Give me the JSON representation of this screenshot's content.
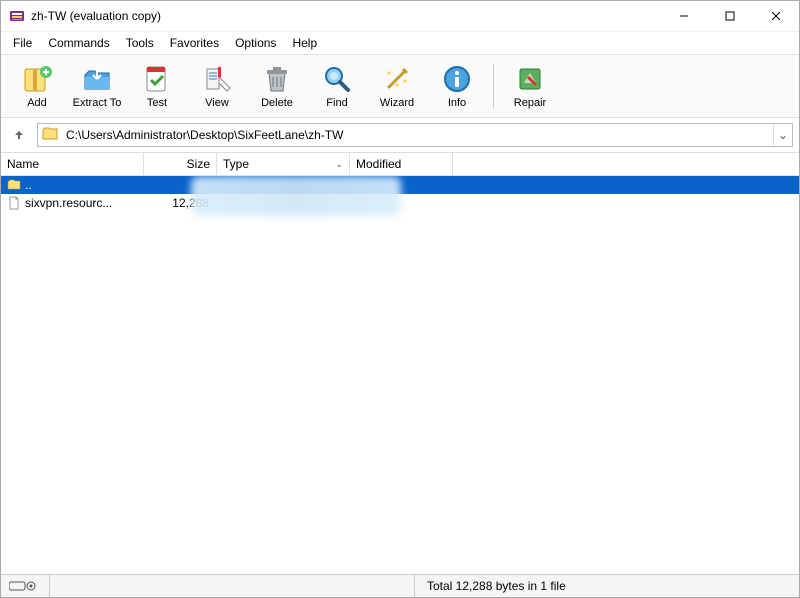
{
  "window": {
    "title": "zh-TW (evaluation copy)"
  },
  "menu": {
    "file": "File",
    "commands": "Commands",
    "tools": "Tools",
    "favorites": "Favorites",
    "options": "Options",
    "help": "Help"
  },
  "toolbar": {
    "add": "Add",
    "extract": "Extract To",
    "test": "Test",
    "view": "View",
    "delete": "Delete",
    "find": "Find",
    "wizard": "Wizard",
    "info": "Info",
    "repair": "Repair"
  },
  "nav": {
    "path": "C:\\Users\\Administrator\\Desktop\\SixFeetLane\\zh-TW"
  },
  "columns": {
    "name": "Name",
    "size": "Size",
    "type": "Type",
    "modified": "Modified"
  },
  "rows": {
    "parent": {
      "name": ".."
    },
    "file1": {
      "name": "sixvpn.resourc...",
      "size": "12,288"
    }
  },
  "status": {
    "text": "Total 12,288 bytes in 1 file"
  }
}
